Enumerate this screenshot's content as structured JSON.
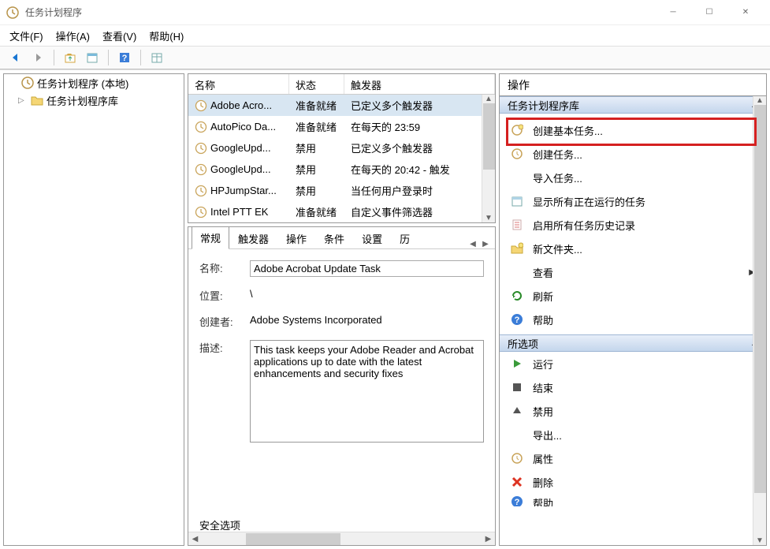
{
  "app": {
    "title": "任务计划程序"
  },
  "menu": {
    "file": "文件(F)",
    "action": "操作(A)",
    "view": "查看(V)",
    "help": "帮助(H)"
  },
  "tree": {
    "root": "任务计划程序 (本地)",
    "library": "任务计划程序库"
  },
  "columns": {
    "name": "名称",
    "state": "状态",
    "trigger": "触发器"
  },
  "tasks": [
    {
      "name": "Adobe Acro...",
      "state": "准备就绪",
      "trigger": "已定义多个触发器",
      "selected": true
    },
    {
      "name": "AutoPico Da...",
      "state": "准备就绪",
      "trigger": "在每天的 23:59"
    },
    {
      "name": "GoogleUpd...",
      "state": "禁用",
      "trigger": "已定义多个触发器"
    },
    {
      "name": "GoogleUpd...",
      "state": "禁用",
      "trigger": "在每天的 20:42 - 触发"
    },
    {
      "name": "HPJumpStar...",
      "state": "禁用",
      "trigger": "当任何用户登录时"
    },
    {
      "name": "Intel PTT EK",
      "state": "准备就绪",
      "trigger": "自定义事件筛选器"
    }
  ],
  "tabs": {
    "general": "常规",
    "triggers": "触发器",
    "actions": "操作",
    "conditions": "条件",
    "settings": "设置",
    "history": "历"
  },
  "detail": {
    "name_label": "名称:",
    "name_value": "Adobe Acrobat Update Task",
    "location_label": "位置:",
    "location_value": "\\",
    "author_label": "创建者:",
    "author_value": "Adobe Systems Incorporated",
    "desc_label": "描述:",
    "desc_value": "This task keeps your Adobe Reader and Acrobat applications up to date with the latest enhancements and security fixes",
    "security_label": "安全选项"
  },
  "actions_panel": {
    "title": "操作",
    "section_library": "任务计划程序库",
    "create_basic": "创建基本任务...",
    "create_task": "创建任务...",
    "import_task": "导入任务...",
    "show_running": "显示所有正在运行的任务",
    "enable_history": "启用所有任务历史记录",
    "new_folder": "新文件夹...",
    "view": "查看",
    "refresh": "刷新",
    "help": "帮助",
    "section_selected": "所选项",
    "run": "运行",
    "end": "结束",
    "disable": "禁用",
    "export": "导出...",
    "properties": "属性",
    "delete": "删除",
    "help2": "帮助"
  }
}
